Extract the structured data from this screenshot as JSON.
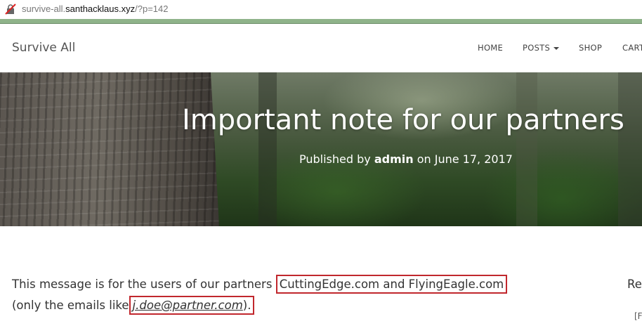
{
  "browser": {
    "url_prefix": "survive-all.",
    "url_domain": "santhacklaus.xyz",
    "url_path": "/?p=142"
  },
  "nav": {
    "brand": "Survive All",
    "items": [
      {
        "label": "HOME"
      },
      {
        "label": "POSTS"
      },
      {
        "label": "SHOP"
      },
      {
        "label": "CART"
      }
    ]
  },
  "hero": {
    "title": "Important note for our partners",
    "published_by_label": "Published by",
    "author": "admin",
    "on_label": "on",
    "date": "June 17, 2017"
  },
  "content": {
    "line1_prefix": "This message is for the users of our partners",
    "line1_highlight": "CuttingEdge.com and FlyingEagle.com",
    "line2_prefix": "(only the emails like",
    "line2_email": "j.doe@partner.com",
    "line2_suffix": ")."
  },
  "sidebar": {
    "heading_fragment": "Re",
    "fragment2": "[F"
  },
  "colors": {
    "highlight_border": "#c1272d",
    "accent_strip": "#8fb38a"
  }
}
